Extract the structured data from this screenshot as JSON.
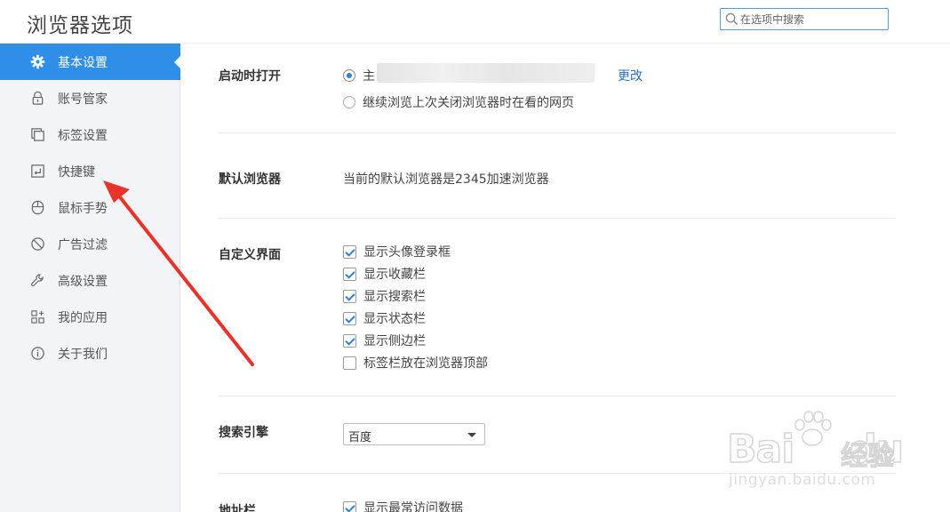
{
  "header": {
    "title": "浏览器选项"
  },
  "search": {
    "placeholder": "在选项中搜索"
  },
  "sidebar": {
    "items": [
      {
        "label": "基本设置",
        "icon": "gear-icon",
        "active": true
      },
      {
        "label": "账号管家",
        "icon": "lock-icon",
        "active": false
      },
      {
        "label": "标签设置",
        "icon": "tabs-icon",
        "active": false
      },
      {
        "label": "快捷键",
        "icon": "keyboard-icon",
        "active": false
      },
      {
        "label": "鼠标手势",
        "icon": "mouse-icon",
        "active": false
      },
      {
        "label": "广告过滤",
        "icon": "block-icon",
        "active": false
      },
      {
        "label": "高级设置",
        "icon": "wrench-icon",
        "active": false
      },
      {
        "label": "我的应用",
        "icon": "apps-icon",
        "active": false
      },
      {
        "label": "关于我们",
        "icon": "info-icon",
        "active": false
      }
    ]
  },
  "startup": {
    "label": "启动时打开",
    "option_homepage": "主",
    "option_continue": "继续浏览上次关闭浏览器时在看的网页",
    "change_link": "更改"
  },
  "default_browser": {
    "label": "默认浏览器",
    "text": "当前的默认浏览器是2345加速浏览器"
  },
  "custom_ui": {
    "label": "自定义界面",
    "options": [
      {
        "label": "显示头像登录框",
        "checked": true
      },
      {
        "label": "显示收藏栏",
        "checked": true
      },
      {
        "label": "显示搜索栏",
        "checked": true
      },
      {
        "label": "显示状态栏",
        "checked": true
      },
      {
        "label": "显示侧边栏",
        "checked": true
      },
      {
        "label": "标签栏放在浏览器顶部",
        "checked": false
      }
    ]
  },
  "search_engine": {
    "label": "搜索引擎",
    "selected": "百度"
  },
  "address_bar": {
    "label": "地址栏",
    "option": "显示最常访问数据",
    "checked": true
  },
  "watermark": {
    "brand": "Bai",
    "brand_tail": "du",
    "product": "经验",
    "url": "jingyan.baidu.com"
  },
  "colors": {
    "accent": "#2f8ee8",
    "link": "#2a70c2",
    "annotation_arrow": "#e8332a"
  }
}
